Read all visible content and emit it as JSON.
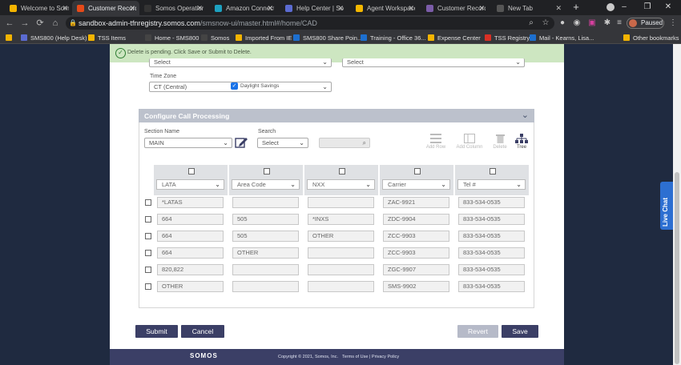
{
  "browser": {
    "tabs": [
      {
        "title": "Welcome to Som",
        "active": false,
        "icon_color": "#f4b400"
      },
      {
        "title": "Customer Record",
        "active": true,
        "icon_color": "#e64a19"
      },
      {
        "title": "Somos Operation",
        "active": false,
        "icon_color": "#333333"
      },
      {
        "title": "Amazon Connect",
        "active": false,
        "icon_color": "#1da1c0"
      },
      {
        "title": "Help Center | So",
        "active": false,
        "icon_color": "#5b6bd1"
      },
      {
        "title": "Agent Workspace",
        "active": false,
        "icon_color": "#f5b800"
      },
      {
        "title": "Customer Record",
        "active": false,
        "icon_color": "#7b5ca8"
      },
      {
        "title": "New Tab",
        "active": false,
        "icon_color": "#555555"
      }
    ],
    "url_host": "sandbox-admin-tfnregistry.somos.com",
    "url_path": "/smsnow-ui/master.html#/home/CAD",
    "profile_label": "Paused",
    "bookmarks": [
      {
        "label": "",
        "icon_color": "#f4b400"
      },
      {
        "label": "SMS800 (Help Desk)",
        "icon_color": "#5b6bd1"
      },
      {
        "label": "TSS Items",
        "icon_color": "#f4b400"
      },
      {
        "label": "Home - SMS800",
        "icon_color": "#444444"
      },
      {
        "label": "Somos",
        "icon_color": "#444444"
      },
      {
        "label": "Imported From IE",
        "icon_color": "#f4b400"
      },
      {
        "label": "SMS800 Share Poin...",
        "icon_color": "#1d6fcf"
      },
      {
        "label": "Training - Office 36...",
        "icon_color": "#1d6fcf"
      },
      {
        "label": "Expense Center",
        "icon_color": "#f4b400"
      },
      {
        "label": "TSS Registry",
        "icon_color": "#d93025"
      },
      {
        "label": "Mail - Kearns, Lisa...",
        "icon_color": "#1d6fcf"
      },
      {
        "label": "Other bookmarks",
        "icon_color": "#f4b400"
      }
    ]
  },
  "banner": {
    "message": "Delete is pending. Click Save or Submit to Delete."
  },
  "top_form": {
    "select_left": "Select",
    "select_right": "Select",
    "time_zone_label": "Time Zone",
    "time_zone_value": "CT (Central)",
    "daylight_savings_label": "Daylight Savings",
    "daylight_savings_checked": true
  },
  "ccp": {
    "header": "Configure Call Processing",
    "section_name_label": "Section Name",
    "section_name_value": "MAIN",
    "search_label": "Search",
    "search_select_value": "Select",
    "search_placeholder": "",
    "tools": {
      "add_row": "Add Row",
      "add_column": "Add Column",
      "delete": "Delete",
      "tree": "Tree"
    },
    "columns": [
      "LATA",
      "Area Code",
      "NXX",
      "Carrier",
      "Tel #"
    ],
    "rows": [
      [
        "*LATAS",
        "",
        "",
        "ZAC-9921",
        "833-534-0535"
      ],
      [
        "664",
        "505",
        "*INXS",
        "ZDC-9904",
        "833-534-0535"
      ],
      [
        "664",
        "505",
        "OTHER",
        "ZCC-9903",
        "833-534-0535"
      ],
      [
        "664",
        "OTHER",
        "",
        "ZCC-9903",
        "833-534-0535"
      ],
      [
        "820,822",
        "",
        "",
        "ZGC-9907",
        "833-534-0535"
      ],
      [
        "OTHER",
        "",
        "",
        "SMS-9902",
        "833-534-0535"
      ]
    ]
  },
  "actions": {
    "submit": "Submit",
    "cancel": "Cancel",
    "revert": "Revert",
    "save": "Save"
  },
  "footer": {
    "logo": "SOMOS",
    "copyright": "Copyright © 2021, Somos, Inc.",
    "terms": "Terms of Use",
    "separator": "|",
    "privacy": "Privacy Policy"
  },
  "live_chat": "Live Chat",
  "colors": {
    "banner_bg": "#cde6c1",
    "primary_button": "#3b3f66",
    "footer_bg": "#3b3f66",
    "live_chat_bg": "#2d6fd1",
    "revert_disabled": "#b6bac8"
  }
}
